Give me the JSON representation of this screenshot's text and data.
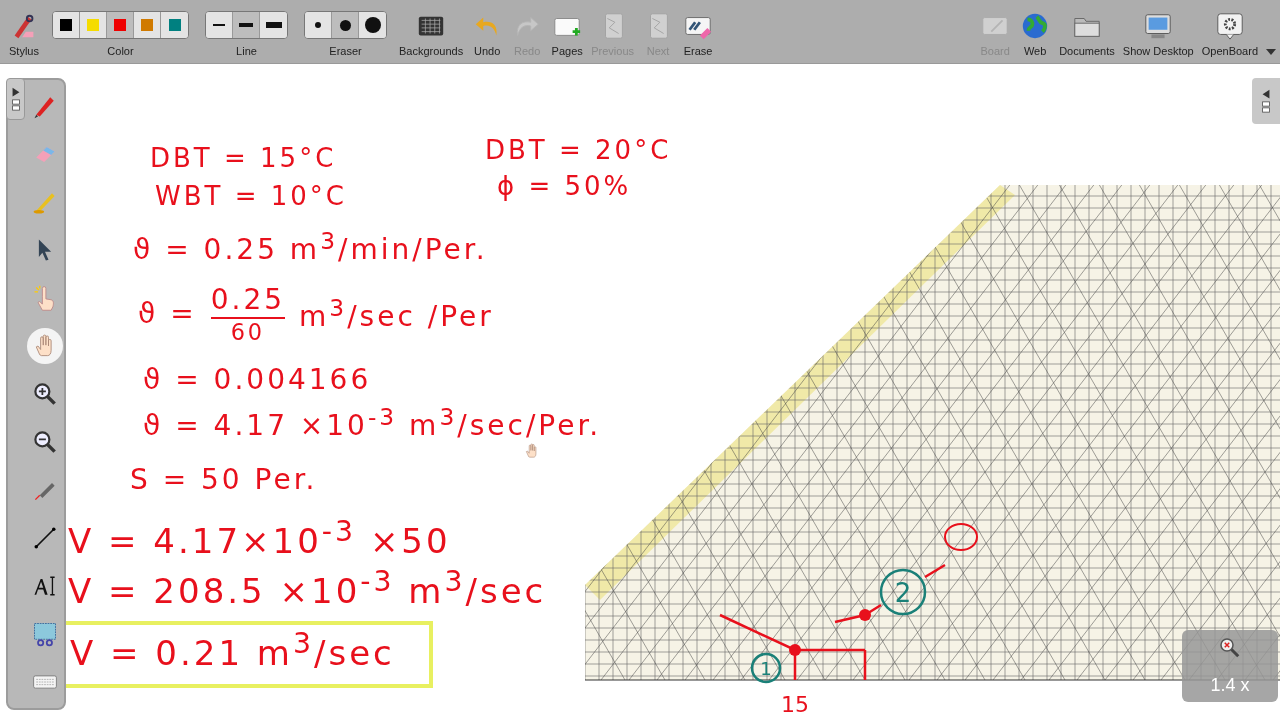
{
  "toolbar": {
    "groups": [
      {
        "kind": "button",
        "label": "Stylus",
        "disabled": false
      },
      {
        "kind": "colors",
        "label": "Color",
        "options": [
          {
            "color": "#000000",
            "selected": false
          },
          {
            "color": "#f5dc00",
            "selected": false
          },
          {
            "color": "#ee0000",
            "selected": true
          },
          {
            "color": "#d07a00",
            "selected": false
          },
          {
            "color": "#008080",
            "selected": false
          }
        ]
      },
      {
        "kind": "line-sizes",
        "label": "Line",
        "options": [
          {
            "selected": false
          },
          {
            "selected": true
          },
          {
            "selected": false
          }
        ]
      },
      {
        "kind": "eraser-sizes",
        "label": "Eraser",
        "options": [
          {
            "selected": false
          },
          {
            "selected": true
          },
          {
            "selected": false
          }
        ]
      },
      {
        "kind": "button",
        "label": "Backgrounds",
        "disabled": false
      },
      {
        "kind": "button",
        "label": "Undo",
        "disabled": false
      },
      {
        "kind": "button",
        "label": "Redo",
        "disabled": true
      },
      {
        "kind": "button",
        "label": "Pages",
        "disabled": false
      },
      {
        "kind": "button",
        "label": "Previous",
        "disabled": true
      },
      {
        "kind": "button",
        "label": "Next",
        "disabled": true
      },
      {
        "kind": "button",
        "label": "Erase",
        "disabled": false
      },
      {
        "kind": "spacer"
      },
      {
        "kind": "button",
        "label": "Board",
        "disabled": true
      },
      {
        "kind": "button",
        "label": "Web",
        "disabled": false
      },
      {
        "kind": "button",
        "label": "Documents",
        "disabled": false
      },
      {
        "kind": "button",
        "label": "Show Desktop",
        "disabled": false
      },
      {
        "kind": "button",
        "label": "OpenBoard",
        "disabled": false
      }
    ]
  },
  "palette": {
    "tools": [
      {
        "selected": false
      },
      {
        "selected": false
      },
      {
        "selected": false
      },
      {
        "selected": false
      },
      {
        "selected": false
      },
      {
        "selected": true
      },
      {
        "selected": false
      },
      {
        "selected": false
      },
      {
        "selected": false
      },
      {
        "selected": false
      },
      {
        "selected": false
      },
      {
        "selected": false
      },
      {
        "selected": false
      }
    ]
  },
  "board": {
    "notes": [
      {
        "kind": "plain",
        "text": "DBT = 15°C"
      },
      {
        "kind": "plain",
        "text": "WBT = 10°C"
      },
      {
        "kind": "plain",
        "text": "ϑ = 0.25 m$^{3}$/min/Per."
      },
      {
        "kind": "fraction",
        "prefix": "ϑ =",
        "numerator": "0.25",
        "denominator": "60",
        "suffix": "m$^{3}$/sec /Per"
      },
      {
        "kind": "plain",
        "text": "ϑ = 0.004166"
      },
      {
        "kind": "plain",
        "text": "ϑ = 4.17 ×10$^{-3}$ m$^{3}$/sec/Per."
      },
      {
        "kind": "plain",
        "text": "S = 50 Per."
      },
      {
        "kind": "plain",
        "text": "V = 4.17×10$^{-3}$ ×50"
      },
      {
        "kind": "plain",
        "text": "V = 208.5 ×10$^{-3}$ m$^{3}$/sec"
      },
      {
        "kind": "highlight",
        "text": "V = 0.21 m$^{3}$/sec"
      },
      {
        "kind": "plain",
        "text": "DBT = 20°C"
      },
      {
        "kind": "plain",
        "text": "ϕ = 50%"
      }
    ],
    "chart": {
      "point_labels": [
        "1",
        "2"
      ],
      "axis_note": "15"
    },
    "zoom_level": "1.4 x"
  }
}
